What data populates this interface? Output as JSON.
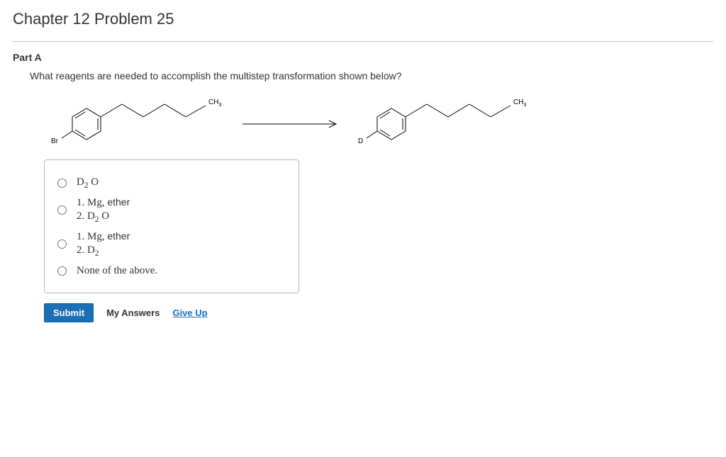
{
  "title": "Chapter 12 Problem 25",
  "part": {
    "label": "Part A"
  },
  "question": "What reagents are needed to accomplish the multistep transformation shown below?",
  "reaction": {
    "start_substituent": "Br",
    "product_substituent": "D",
    "chain_end_label": "CH",
    "chain_end_sub": "3"
  },
  "choices": {
    "a": {
      "html": "D<sub>2</sub> O"
    },
    "b": {
      "line1_html": "1. Mg, <span class=\"sans\">ether</span>",
      "line2_html": "2. D<sub>2</sub> O"
    },
    "c": {
      "line1_html": "1. Mg, <span class=\"sans\">ether</span>",
      "line2_html": "2. D<sub>2</sub>"
    },
    "d": {
      "text": "None of the above."
    }
  },
  "actions": {
    "submit": "Submit",
    "my_answers": "My Answers",
    "give_up": "Give Up"
  }
}
